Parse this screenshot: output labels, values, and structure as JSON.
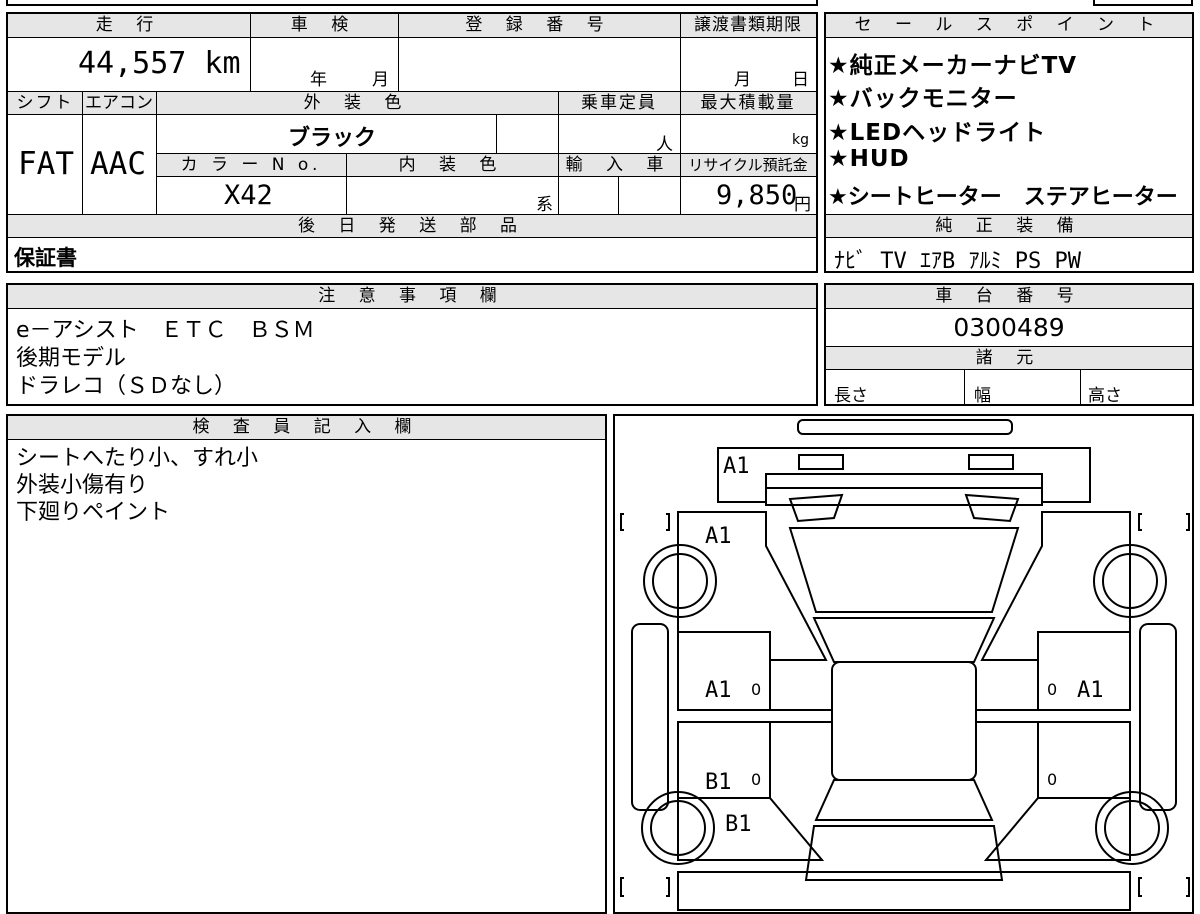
{
  "vehicle": {
    "mileage_header": "走 行",
    "mileage": "44,557 km",
    "inspection_header": "車 検",
    "inspection_year_unit": "年",
    "inspection_month_unit": "月",
    "registration_header": "登 録 番 号",
    "transfer_header": "譲渡書類期限",
    "transfer_month_unit": "月",
    "transfer_day_unit": "日",
    "shift_header": "シフト",
    "shift": "FAT",
    "aircon_header": "エアコン",
    "aircon": "AAC",
    "exterior_color_header": "外 装 色",
    "exterior_color": "ブラック",
    "capacity_header": "乗車定員",
    "capacity_unit": "人",
    "max_load_header": "最大積載量",
    "max_load_unit": "kg",
    "color_no_header": "カ ラ ー N o.",
    "color_no": "X42",
    "interior_color_header": "内 装 色",
    "interior_color_suffix": "系",
    "import_header": "輸 入 車",
    "recycle_header": "リサイクル預託金",
    "recycle_fee": "9,850",
    "recycle_unit": "円"
  },
  "later_parts": {
    "header": "後 日 発 送 部 品",
    "value": "保証書"
  },
  "sales_points": {
    "header": "セ ー ル ス ポ イ ン ト",
    "items": [
      "★純正メーカーナビTV",
      "★バックモニター",
      "★LEDヘッドライト",
      "★HUD",
      "★シートヒーター　ステアヒーター"
    ]
  },
  "equipment": {
    "header": "純 正 装 備",
    "items": [
      "ﾅﾋﾞ",
      "TV",
      "ｴｱB",
      "ｱﾙﾐ",
      "PS",
      "PW"
    ]
  },
  "notes": {
    "header": "注 意 事 項 欄",
    "lines": [
      "e－アシスト　ＥＴＣ　ＢＳＭ",
      "後期モデル",
      "ドラレコ（ＳＤなし）"
    ]
  },
  "chassis": {
    "header": "車 台 番 号",
    "number": "0300489"
  },
  "specs": {
    "header": "諸 元",
    "length": "長さ",
    "width": "幅",
    "height": "高さ"
  },
  "inspector": {
    "header": "検 査 員 記 入 欄",
    "lines": [
      "シートへたり小、すれ小",
      "外装小傷有り",
      "下廻りペイント"
    ]
  },
  "diagram": {
    "marks": [
      "A1",
      "A1",
      "A1",
      "A1",
      "B1",
      "B1"
    ],
    "zeros": [
      "0",
      "0",
      "0",
      "0"
    ],
    "bracket_open": "[",
    "bracket_close": "]"
  }
}
